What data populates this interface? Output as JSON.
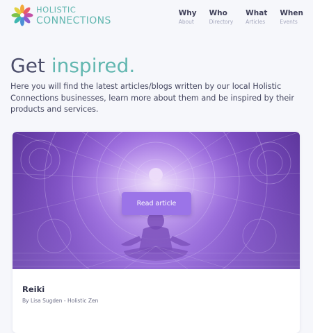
{
  "brand": {
    "line1": "HOLISTIC",
    "line2": "CONNECTIONS",
    "logo_icon": "flower-logo-icon",
    "accent_color": "#62b7b0"
  },
  "nav": {
    "items": [
      {
        "label": "Why",
        "sub": "About"
      },
      {
        "label": "Who",
        "sub": "Directory"
      },
      {
        "label": "What",
        "sub": "Articles"
      },
      {
        "label": "When",
        "sub": "Events"
      }
    ]
  },
  "hero": {
    "title_prefix": "Get",
    "title_accent": "inspired.",
    "description": "Here you will find the latest articles/blogs written by our local Holistic Connections businesses, learn more about them and be inspired by their products and services."
  },
  "articles": [
    {
      "title": "Reiki",
      "author": "By Lisa Sugden - Holistic Zen",
      "button_label": "Read article",
      "image_icon": "meditation-image",
      "button_color": "#9b74e8"
    }
  ]
}
